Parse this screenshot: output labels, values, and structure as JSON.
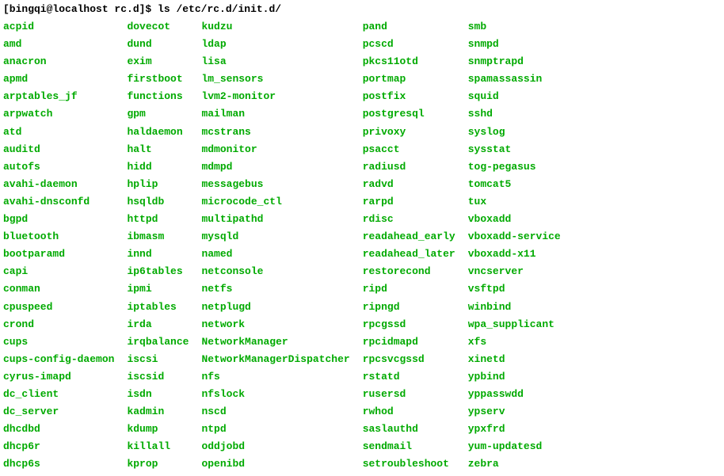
{
  "prompt": {
    "user_host": "[bingqi@localhost rc.d]$ ",
    "command": "ls /etc/rc.d/init.d/"
  },
  "columns": [
    [
      "acpid",
      "amd",
      "anacron",
      "apmd",
      "arptables_jf",
      "arpwatch",
      "atd",
      "auditd",
      "autofs",
      "avahi-daemon",
      "avahi-dnsconfd",
      "bgpd",
      "bluetooth",
      "bootparamd",
      "capi",
      "conman",
      "cpuspeed",
      "crond",
      "cups",
      "cups-config-daemon",
      "cyrus-imapd",
      "dc_client",
      "dc_server",
      "dhcdbd",
      "dhcp6r",
      "dhcp6s"
    ],
    [
      "dovecot",
      "dund",
      "exim",
      "firstboot",
      "functions",
      "gpm",
      "haldaemon",
      "halt",
      "hidd",
      "hplip",
      "hsqldb",
      "httpd",
      "ibmasm",
      "innd",
      "ip6tables",
      "ipmi",
      "iptables",
      "irda",
      "irqbalance",
      "iscsi",
      "iscsid",
      "isdn",
      "kadmin",
      "kdump",
      "killall",
      "kprop"
    ],
    [
      "kudzu",
      "ldap",
      "lisa",
      "lm_sensors",
      "lvm2-monitor",
      "mailman",
      "mcstrans",
      "mdmonitor",
      "mdmpd",
      "messagebus",
      "microcode_ctl",
      "multipathd",
      "mysqld",
      "named",
      "netconsole",
      "netfs",
      "netplugd",
      "network",
      "NetworkManager",
      "NetworkManagerDispatcher",
      "nfs",
      "nfslock",
      "nscd",
      "ntpd",
      "oddjobd",
      "openibd"
    ],
    [
      "pand",
      "pcscd",
      "pkcs11otd",
      "portmap",
      "postfix",
      "postgresql",
      "privoxy",
      "psacct",
      "radiusd",
      "radvd",
      "rarpd",
      "rdisc",
      "readahead_early",
      "readahead_later",
      "restorecond",
      "ripd",
      "ripngd",
      "rpcgssd",
      "rpcidmapd",
      "rpcsvcgssd",
      "rstatd",
      "rusersd",
      "rwhod",
      "saslauthd",
      "sendmail",
      "setroubleshoot"
    ],
    [
      "smb",
      "snmpd",
      "snmptrapd",
      "spamassassin",
      "squid",
      "sshd",
      "syslog",
      "sysstat",
      "tog-pegasus",
      "tomcat5",
      "tux",
      "vboxadd",
      "vboxadd-service",
      "vboxadd-x11",
      "vncserver",
      "vsftpd",
      "winbind",
      "wpa_supplicant",
      "xfs",
      "xinetd",
      "ypbind",
      "yppasswdd",
      "ypserv",
      "ypxfrd",
      "yum-updatesd",
      "zebra"
    ]
  ]
}
